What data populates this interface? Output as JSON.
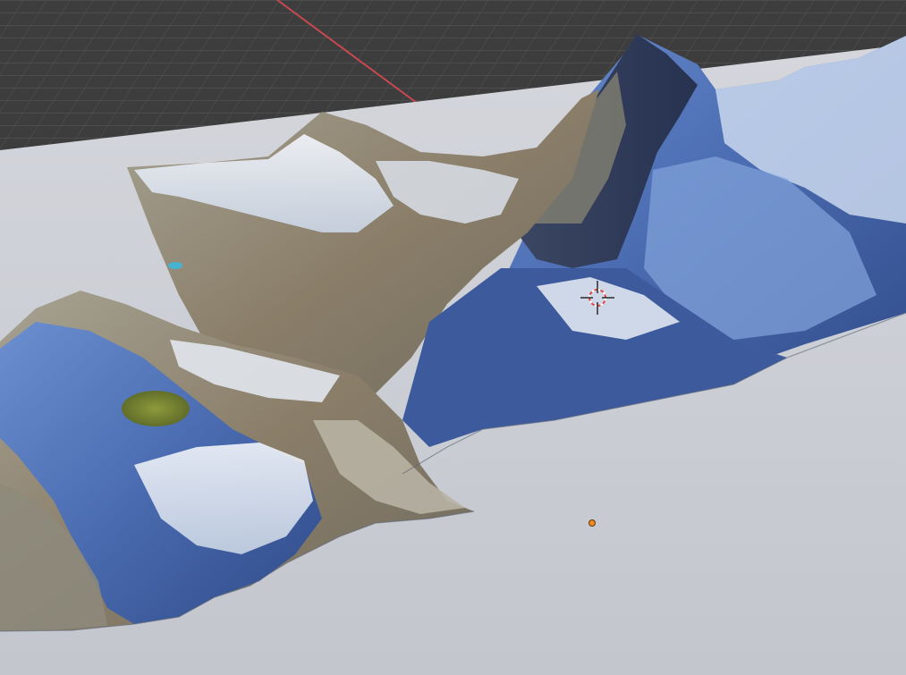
{
  "viewport": {
    "view": "perspective",
    "grid_visible": true,
    "x_axis_visible": true
  },
  "scene": {
    "objects": [
      {
        "name_icon": "terrain-mesh",
        "kind": "textured-terrain",
        "description_icon": "mountain-landscape"
      },
      {
        "name_icon": "ground-plane",
        "kind": "plane"
      }
    ]
  },
  "colors": {
    "grid_background": "#3d3d3d",
    "grid_line": "#555555",
    "x_axis": "#c8484f",
    "plane": "#c9ccd2",
    "plane_shadow": "#b9bcc3",
    "cursor_ring_red": "#e04848",
    "cursor_ring_white": "#ffffff",
    "origin_dot": "#f08a1c",
    "snow": "#e8eef7",
    "glacier_blue": "#5a7fc0",
    "deep_blue": "#2c4378",
    "rock_brown": "#8c7b63",
    "rock_grey": "#7d8a93",
    "lake_green": "#7d8b2f"
  },
  "markers": {
    "cursor_icon": "3d-cursor-icon",
    "origin_icon": "object-origin-icon"
  }
}
